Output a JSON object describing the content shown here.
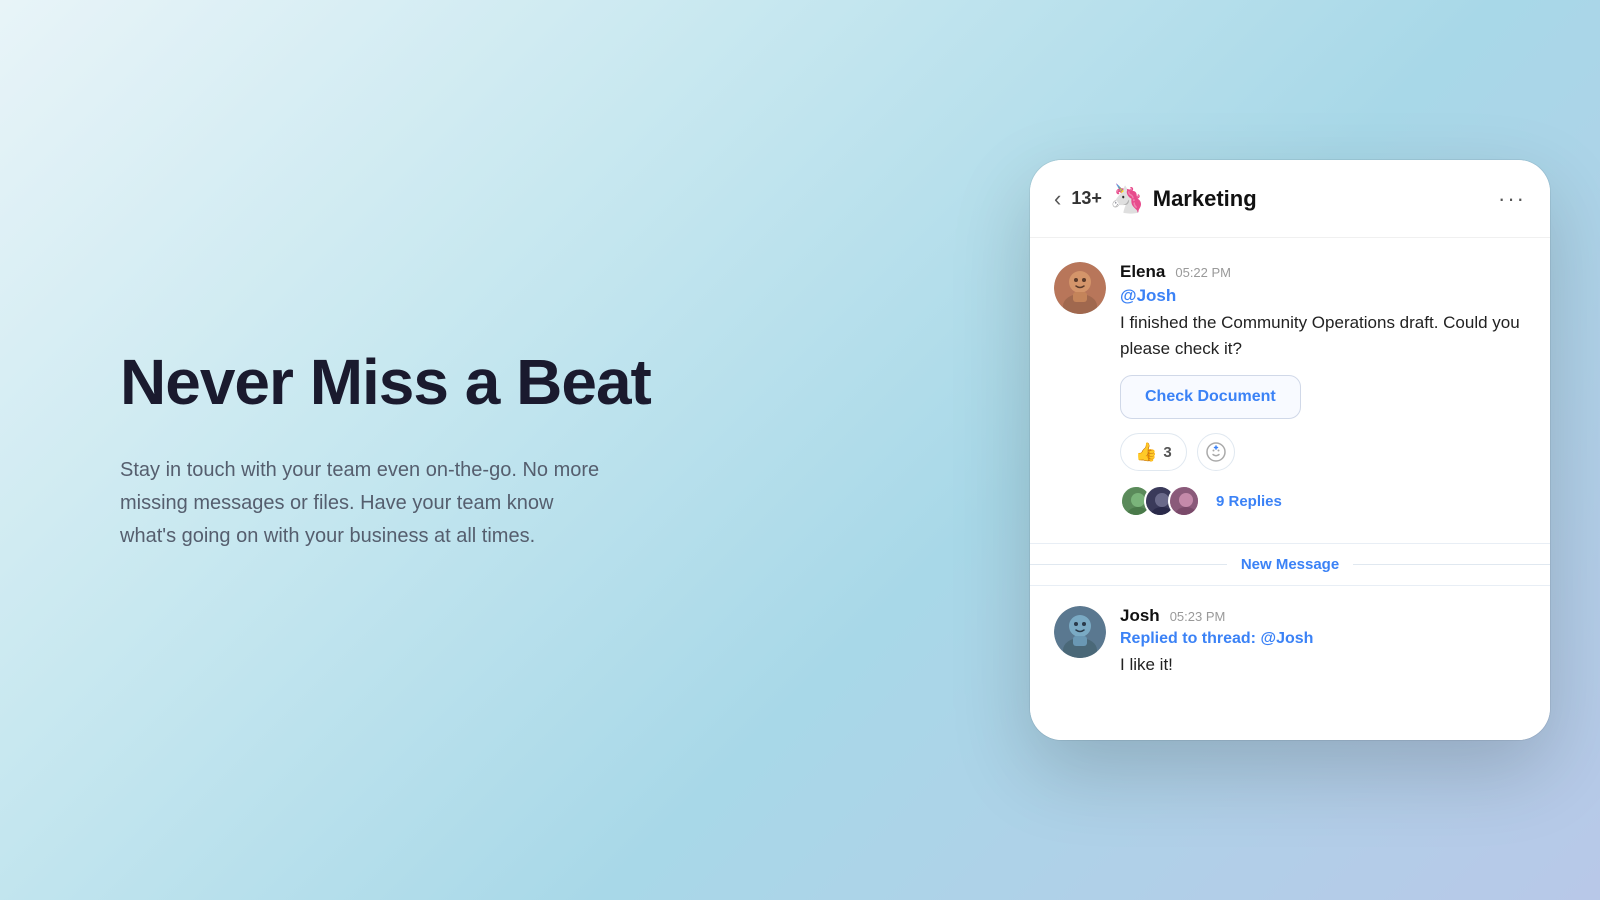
{
  "page": {
    "background": "gradient"
  },
  "left": {
    "headline": "Never Miss a Beat",
    "subtext": "Stay in touch with your team even on-the-go. No more missing messages or files. Have your team know what's going on with your business at all times."
  },
  "chat": {
    "header": {
      "back_label": "‹",
      "member_count": "13+",
      "channel_emoji": "🦄",
      "channel_name": "Marketing",
      "more_label": "···"
    },
    "messages": [
      {
        "id": "msg1",
        "sender": "Elena",
        "timestamp": "05:22 PM",
        "mention": "@Josh",
        "text": "I finished the Community Operations draft. Could you please check it?",
        "action_button": "Check Document",
        "reactions": [
          {
            "emoji": "👍",
            "count": "3"
          }
        ],
        "add_reaction_icon": "⊕",
        "replies": {
          "count_label": "9 Replies",
          "avatar_count": 3
        }
      }
    ],
    "new_message_label": "New Message",
    "second_message": {
      "sender": "Josh",
      "timestamp": "05:23 PM",
      "replied_to_prefix": "Replied to thread:",
      "replied_to_mention": "@Josh",
      "text": "I like it!"
    }
  }
}
